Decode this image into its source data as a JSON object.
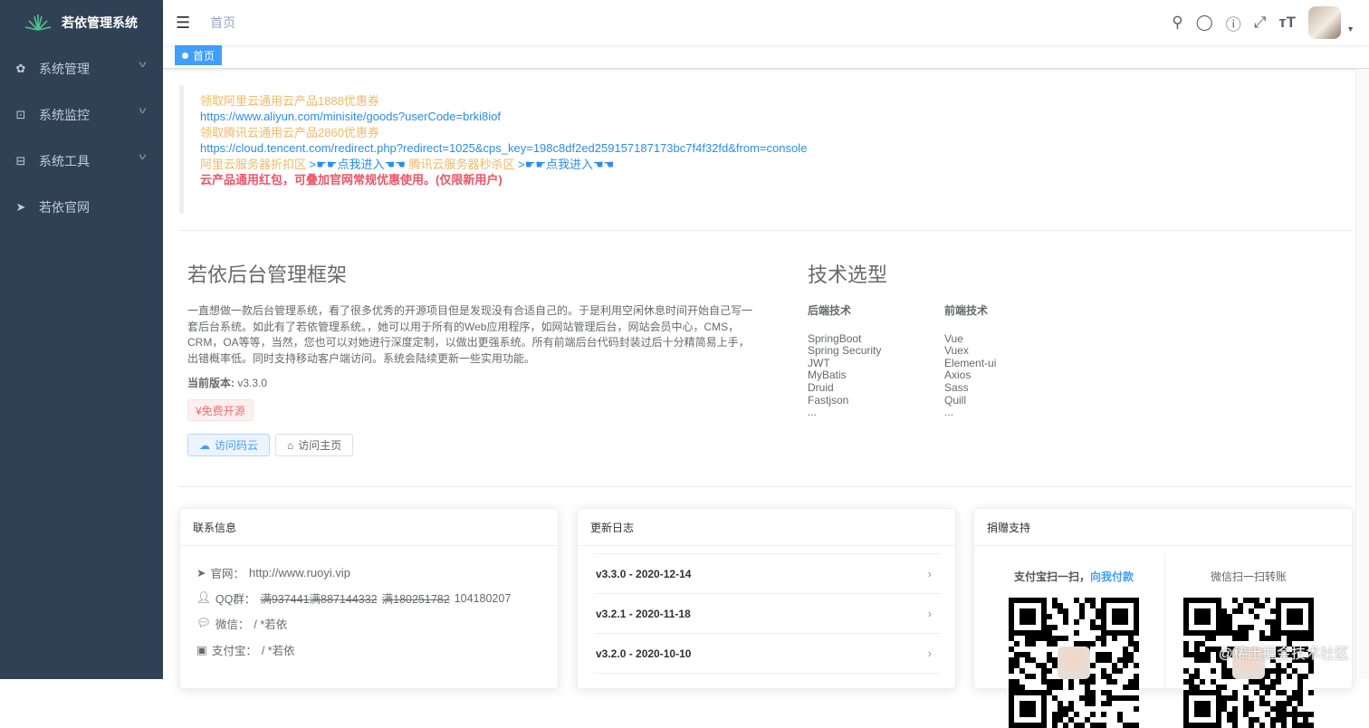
{
  "app": {
    "title": "若依管理系统"
  },
  "sidebar": {
    "items": [
      {
        "label": "系统管理",
        "icon": "gear-icon"
      },
      {
        "label": "系统监控",
        "icon": "monitor-icon"
      },
      {
        "label": "系统工具",
        "icon": "toolbox-icon"
      },
      {
        "label": "若依官网",
        "icon": "send-icon"
      }
    ]
  },
  "navbar": {
    "breadcrumb": "首页",
    "icons": [
      "search-icon",
      "github-icon",
      "question-icon",
      "fullscreen-icon",
      "font-size-icon"
    ]
  },
  "tags": {
    "active": "首页"
  },
  "notice": {
    "l1": "领取阿里云通用云产品1888优惠券",
    "l2": "https://www.aliyun.com/minisite/goods?userCode=brki8iof",
    "l3": "领取腾讯云通用云产品2860优惠券",
    "l4": "https://cloud.tencent.com/redirect.php?redirect=1025&cps_key=198c8df2ed259157187173bc7f4f32fd&from=console",
    "l5a": "阿里云服务器折扣区",
    "l5b": ">☛☛点我进入☚☚",
    "l5c": "腾讯云服务器秒杀区",
    "l5d": ">☛☛点我进入☚☚",
    "l6": "云产品通用红包，可叠加官网常规优惠使用。(仅限新用户)"
  },
  "intro": {
    "title": "若依后台管理框架",
    "desc": "一直想做一款后台管理系统，看了很多优秀的开源项目但是发现没有合适自己的。于是利用空闲休息时间开始自己写一套后台系统。如此有了若依管理系统。，她可以用于所有的Web应用程序，如网站管理后台，网站会员中心，CMS，CRM，OA等等，当然，您也可以对她进行深度定制，以做出更强系统。所有前端后台代码封装过后十分精简易上手，出错概率低。同时支持移动客户端访问。系统会陆续更新一些实用功能。",
    "version_label": "当前版本:",
    "version": "v3.3.0",
    "free": "¥免费开源",
    "btn_gitee": "访问码云",
    "btn_home": "访问主页"
  },
  "tech": {
    "title": "技术选型",
    "backend_title": "后端技术",
    "backend": [
      "SpringBoot",
      "Spring Security",
      "JWT",
      "MyBatis",
      "Druid",
      "Fastjson",
      "..."
    ],
    "frontend_title": "前端技术",
    "frontend": [
      "Vue",
      "Vuex",
      "Element-ui",
      "Axios",
      "Sass",
      "Quill",
      "..."
    ]
  },
  "contact": {
    "title": "联系信息",
    "site_label": "官网：",
    "site": "http://www.ruoyi.vip",
    "qq_label": "QQ群：",
    "qq_full": [
      "满937441",
      "满887144332",
      "满180251782"
    ],
    "qq": "104180207",
    "wechat_label": "微信：",
    "wechat": "/ *若依",
    "alipay_label": "支付宝：",
    "alipay": "/ *若依"
  },
  "changelog": {
    "title": "更新日志",
    "items": [
      "v3.3.0 - 2020-12-14",
      "v3.2.1 - 2020-11-18",
      "v3.2.0 - 2020-10-10"
    ]
  },
  "donate": {
    "title": "捐赠支持",
    "alipay_a": "支付宝扫一扫，",
    "alipay_b": "向我付款",
    "wechat": "微信扫一扫转账"
  },
  "watermark": "@稀土掘金技术社区"
}
